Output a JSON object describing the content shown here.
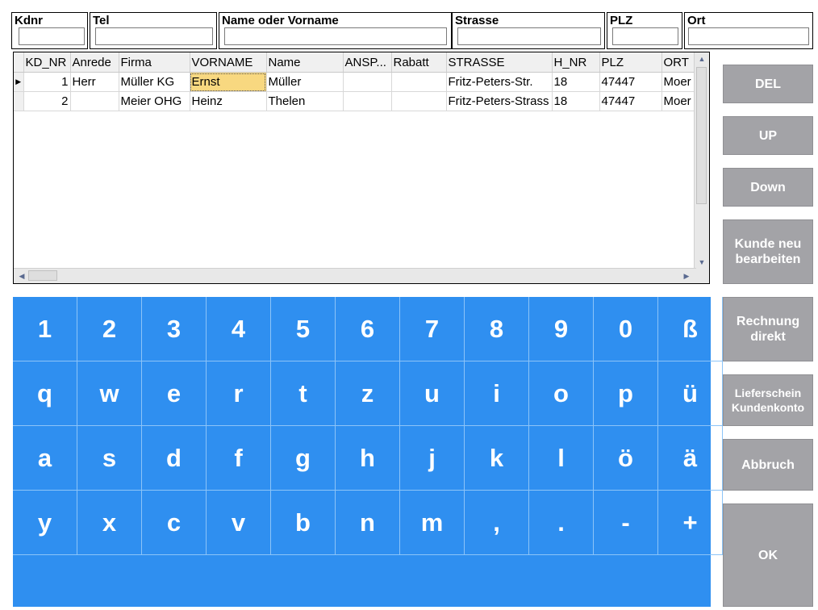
{
  "filters": {
    "kdnr": {
      "label": "Kdnr",
      "value": ""
    },
    "tel": {
      "label": "Tel",
      "value": ""
    },
    "name": {
      "label": "Name oder Vorname",
      "value": ""
    },
    "strasse": {
      "label": "Strasse",
      "value": ""
    },
    "plz": {
      "label": "PLZ",
      "value": ""
    },
    "ort": {
      "label": "Ort",
      "value": ""
    }
  },
  "grid": {
    "columns": [
      "KD_NR",
      "Anrede",
      "Firma",
      "VORNAME",
      "Name",
      "ANSP...",
      "Rabatt",
      "STRASSE",
      "H_NR",
      "PLZ",
      "ORT"
    ],
    "rows": [
      {
        "marker": "▶",
        "cells": [
          "1",
          "Herr",
          "Müller KG",
          "Ernst",
          "Müller",
          "",
          "",
          "Fritz-Peters-Str.",
          "18",
          "47447",
          "Moer"
        ]
      },
      {
        "marker": "",
        "cells": [
          "2",
          "",
          "Meier OHG",
          "Heinz",
          "Thelen",
          "",
          "",
          "Fritz-Peters-Strass",
          "18",
          "47447",
          "Moer"
        ]
      }
    ],
    "selected_cell": {
      "row": 0,
      "col": 3
    }
  },
  "keyboard": {
    "rows": [
      [
        "1",
        "2",
        "3",
        "4",
        "5",
        "6",
        "7",
        "8",
        "9",
        "0",
        "ß"
      ],
      [
        "q",
        "w",
        "e",
        "r",
        "t",
        "z",
        "u",
        "i",
        "o",
        "p",
        "ü"
      ],
      [
        "a",
        "s",
        "d",
        "f",
        "g",
        "h",
        "j",
        "k",
        "l",
        "ö",
        "ä"
      ],
      [
        "y",
        "x",
        "c",
        "v",
        "b",
        "n",
        "m",
        ",",
        ".",
        "-",
        "+"
      ]
    ],
    "space_label": ""
  },
  "side_buttons": [
    {
      "id": "del",
      "label": "DEL"
    },
    {
      "id": "up",
      "label": "UP"
    },
    {
      "id": "down",
      "label": "Down"
    },
    {
      "id": "kunde-neu-bearbeiten",
      "label": "Kunde neu\nbearbeiten"
    },
    {
      "id": "rechnung-direkt",
      "label": "Rechnung\ndirekt"
    },
    {
      "id": "lieferschein-kundenkonto",
      "label": "Lieferschein\nKundenkonto"
    },
    {
      "id": "abbruch",
      "label": "Abbruch"
    },
    {
      "id": "ok",
      "label": "OK"
    }
  ],
  "colors": {
    "keyboard_bg": "#2f8ff0",
    "button_bg": "#a3a3a7",
    "selection": "#f8d880"
  }
}
